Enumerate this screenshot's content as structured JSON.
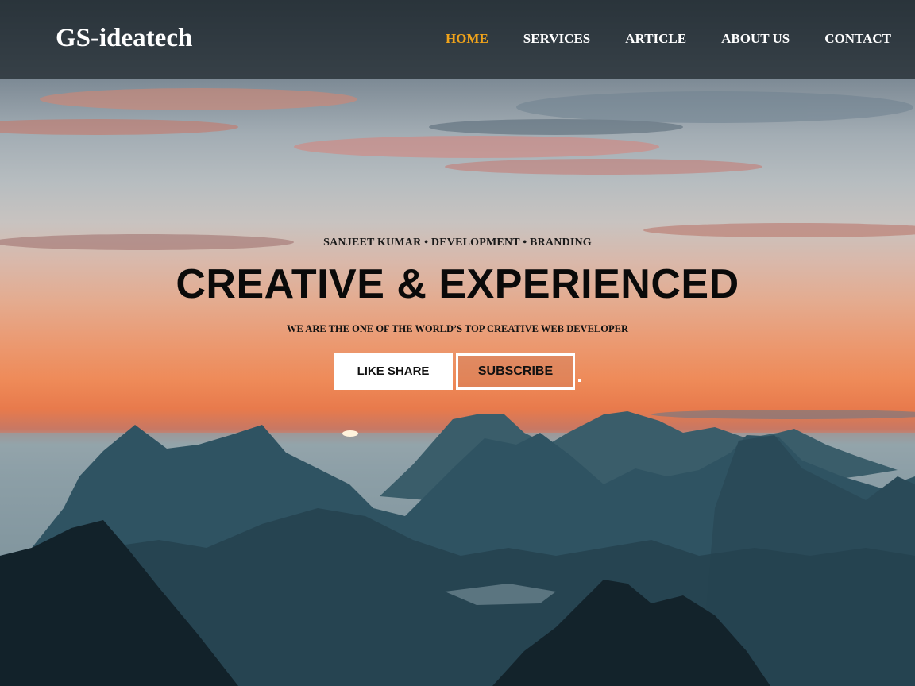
{
  "header": {
    "brand": "GS-ideatech",
    "nav": [
      {
        "label": "HOME",
        "active": true
      },
      {
        "label": "SERVICES",
        "active": false
      },
      {
        "label": "ARTICLE",
        "active": false
      },
      {
        "label": "ABOUT US",
        "active": false
      },
      {
        "label": "CONTACT",
        "active": false
      }
    ]
  },
  "hero": {
    "kicker": "SANJEET KUMAR • DEVELOPMENT • BRANDING",
    "headline": "CREATIVE & EXPERIENCED",
    "tagline": "WE ARE THE ONE OF THE WORLD’S TOP CREATIVE WEB DEVELOPER",
    "buttons": {
      "like_share": "LIKE SHARE",
      "subscribe": "SUBSCRIBE"
    }
  },
  "colors": {
    "nav_active": "#f0a31a",
    "nav_text": "#ffffff",
    "header_bg": "#1c242a"
  }
}
